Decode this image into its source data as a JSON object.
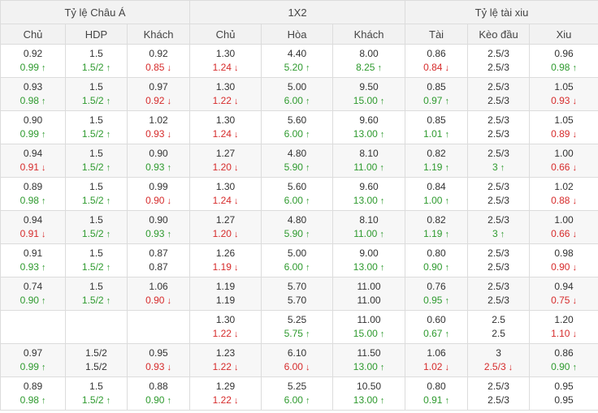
{
  "groups": [
    "Tỷ lệ Châu Á",
    "1X2",
    "Tỷ lệ tài xiu"
  ],
  "columns": [
    "Chủ",
    "HDP",
    "Khách",
    "Chủ",
    "Hòa",
    "Khách",
    "Tài",
    "Kèo đầu",
    "Xiu"
  ],
  "rows": [
    [
      [
        "0.92",
        "0.99",
        "up"
      ],
      [
        "1.5",
        "1.5/2",
        "up"
      ],
      [
        "0.92",
        "0.85",
        "down"
      ],
      [
        "1.30",
        "1.24",
        "down"
      ],
      [
        "4.40",
        "5.20",
        "up"
      ],
      [
        "8.00",
        "8.25",
        "up"
      ],
      [
        "0.86",
        "0.84",
        "down"
      ],
      [
        "2.5/3",
        "2.5/3",
        ""
      ],
      [
        "0.96",
        "0.98",
        "up"
      ]
    ],
    [
      [
        "0.93",
        "0.98",
        "up"
      ],
      [
        "1.5",
        "1.5/2",
        "up"
      ],
      [
        "0.97",
        "0.92",
        "down"
      ],
      [
        "1.30",
        "1.22",
        "down"
      ],
      [
        "5.00",
        "6.00",
        "up"
      ],
      [
        "9.50",
        "15.00",
        "up"
      ],
      [
        "0.85",
        "0.97",
        "up"
      ],
      [
        "2.5/3",
        "2.5/3",
        ""
      ],
      [
        "1.05",
        "0.93",
        "down"
      ]
    ],
    [
      [
        "0.90",
        "0.99",
        "up"
      ],
      [
        "1.5",
        "1.5/2",
        "up"
      ],
      [
        "1.02",
        "0.93",
        "down"
      ],
      [
        "1.30",
        "1.24",
        "down"
      ],
      [
        "5.60",
        "6.00",
        "up"
      ],
      [
        "9.60",
        "13.00",
        "up"
      ],
      [
        "0.85",
        "1.01",
        "up"
      ],
      [
        "2.5/3",
        "2.5/3",
        ""
      ],
      [
        "1.05",
        "0.89",
        "down"
      ]
    ],
    [
      [
        "0.94",
        "0.91",
        "down"
      ],
      [
        "1.5",
        "1.5/2",
        "up"
      ],
      [
        "0.90",
        "0.93",
        "up"
      ],
      [
        "1.27",
        "1.20",
        "down"
      ],
      [
        "4.80",
        "5.90",
        "up"
      ],
      [
        "8.10",
        "11.00",
        "up"
      ],
      [
        "0.82",
        "1.19",
        "up"
      ],
      [
        "2.5/3",
        "3",
        "up"
      ],
      [
        "1.00",
        "0.66",
        "down"
      ]
    ],
    [
      [
        "0.89",
        "0.98",
        "up"
      ],
      [
        "1.5",
        "1.5/2",
        "up"
      ],
      [
        "0.99",
        "0.90",
        "down"
      ],
      [
        "1.30",
        "1.24",
        "down"
      ],
      [
        "5.60",
        "6.00",
        "up"
      ],
      [
        "9.60",
        "13.00",
        "up"
      ],
      [
        "0.84",
        "1.00",
        "up"
      ],
      [
        "2.5/3",
        "2.5/3",
        ""
      ],
      [
        "1.02",
        "0.88",
        "down"
      ]
    ],
    [
      [
        "0.94",
        "0.91",
        "down"
      ],
      [
        "1.5",
        "1.5/2",
        "up"
      ],
      [
        "0.90",
        "0.93",
        "up"
      ],
      [
        "1.27",
        "1.20",
        "down"
      ],
      [
        "4.80",
        "5.90",
        "up"
      ],
      [
        "8.10",
        "11.00",
        "up"
      ],
      [
        "0.82",
        "1.19",
        "up"
      ],
      [
        "2.5/3",
        "3",
        "up"
      ],
      [
        "1.00",
        "0.66",
        "down"
      ]
    ],
    [
      [
        "0.91",
        "0.93",
        "up"
      ],
      [
        "1.5",
        "1.5/2",
        "up"
      ],
      [
        "0.87",
        "0.87",
        ""
      ],
      [
        "1.26",
        "1.19",
        "down"
      ],
      [
        "5.00",
        "6.00",
        "up"
      ],
      [
        "9.00",
        "13.00",
        "up"
      ],
      [
        "0.80",
        "0.90",
        "up"
      ],
      [
        "2.5/3",
        "2.5/3",
        ""
      ],
      [
        "0.98",
        "0.90",
        "down"
      ]
    ],
    [
      [
        "0.74",
        "0.90",
        "up"
      ],
      [
        "1.5",
        "1.5/2",
        "up"
      ],
      [
        "1.06",
        "0.90",
        "down"
      ],
      [
        "1.19",
        "1.19",
        ""
      ],
      [
        "5.70",
        "5.70",
        ""
      ],
      [
        "11.00",
        "11.00",
        ""
      ],
      [
        "0.76",
        "0.95",
        "up"
      ],
      [
        "2.5/3",
        "2.5/3",
        ""
      ],
      [
        "0.94",
        "0.75",
        "down"
      ]
    ],
    [
      [
        "",
        "",
        ""
      ],
      [
        "",
        "",
        ""
      ],
      [
        "",
        "",
        ""
      ],
      [
        "1.30",
        "1.22",
        "down"
      ],
      [
        "5.25",
        "5.75",
        "up"
      ],
      [
        "11.00",
        "15.00",
        "up"
      ],
      [
        "0.60",
        "0.67",
        "up"
      ],
      [
        "2.5",
        "2.5",
        ""
      ],
      [
        "1.20",
        "1.10",
        "down"
      ]
    ],
    [
      [
        "0.97",
        "0.99",
        "up"
      ],
      [
        "1.5/2",
        "1.5/2",
        ""
      ],
      [
        "0.95",
        "0.93",
        "down"
      ],
      [
        "1.23",
        "1.22",
        "down"
      ],
      [
        "6.10",
        "6.00",
        "down"
      ],
      [
        "11.50",
        "13.00",
        "up"
      ],
      [
        "1.06",
        "1.02",
        "down"
      ],
      [
        "3",
        "2.5/3",
        "down"
      ],
      [
        "0.86",
        "0.90",
        "up"
      ]
    ],
    [
      [
        "0.89",
        "0.98",
        "up"
      ],
      [
        "1.5",
        "1.5/2",
        "up"
      ],
      [
        "0.88",
        "0.90",
        "up"
      ],
      [
        "1.29",
        "1.22",
        "down"
      ],
      [
        "5.25",
        "6.00",
        "up"
      ],
      [
        "10.50",
        "13.00",
        "up"
      ],
      [
        "0.80",
        "0.91",
        "up"
      ],
      [
        "2.5/3",
        "2.5/3",
        ""
      ],
      [
        "0.95",
        "0.95",
        ""
      ]
    ]
  ],
  "colors": {
    "up": "#2e9a2e",
    "down": "#d62b2b",
    "header_bg": "#f2f2f2",
    "border": "#dcdcdc"
  }
}
